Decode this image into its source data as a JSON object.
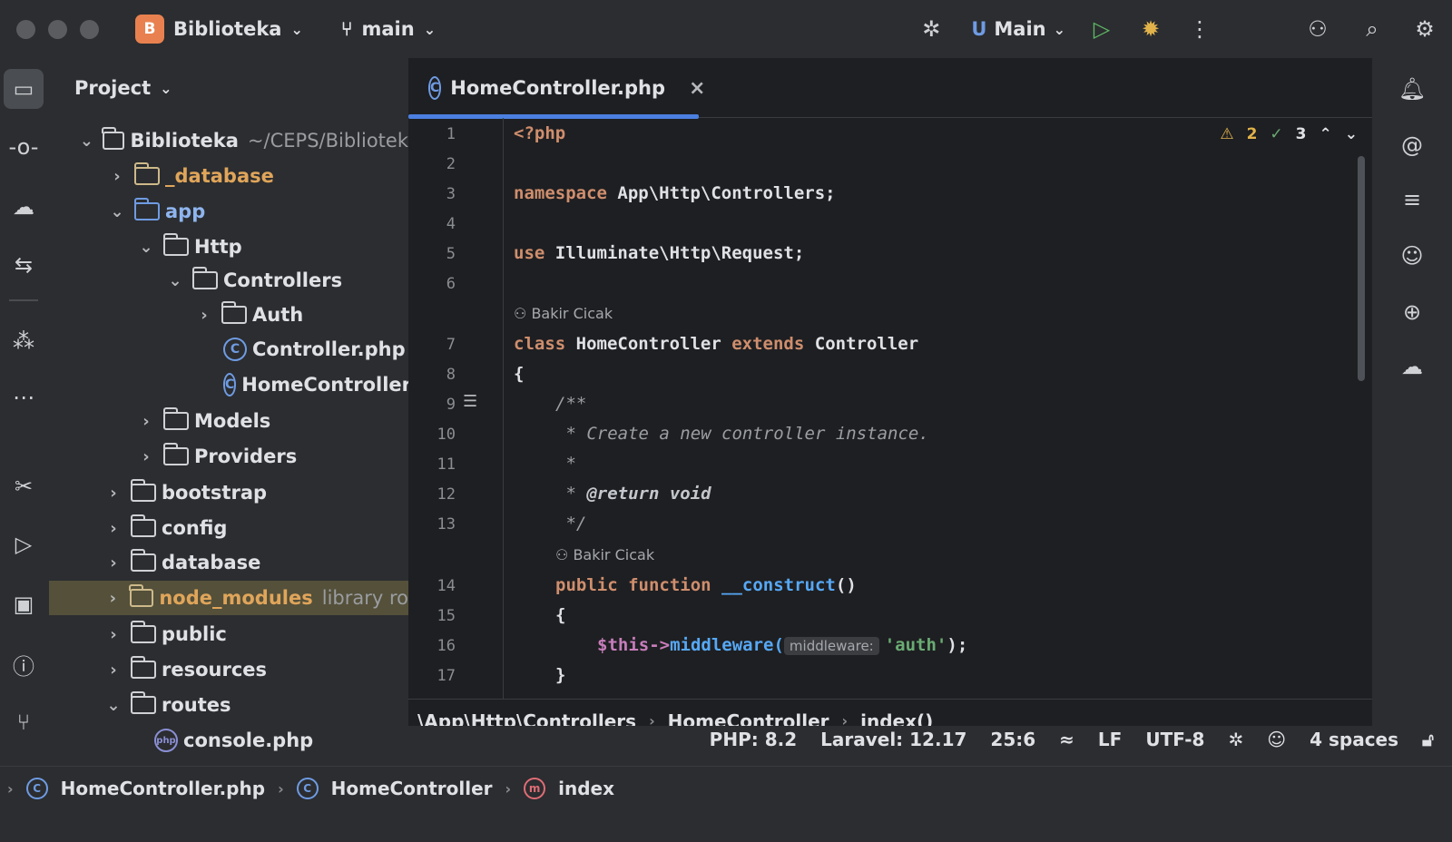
{
  "titlebar": {
    "project_badge": "B",
    "project_name": "Biblioteka",
    "branch": "main",
    "run_config": "Main"
  },
  "project_panel": {
    "title": "Project",
    "tree": [
      {
        "label": "Biblioteka",
        "suffix": "~/CEPS/Bibliotek",
        "kind": "folder",
        "expanded": true
      },
      {
        "label": "_database",
        "kind": "folder",
        "expanded": false
      },
      {
        "label": "app",
        "kind": "folder",
        "expanded": true
      },
      {
        "label": "Http",
        "kind": "folder",
        "expanded": true
      },
      {
        "label": "Controllers",
        "kind": "folder",
        "expanded": true
      },
      {
        "label": "Auth",
        "kind": "folder",
        "expanded": false
      },
      {
        "label": "Controller.php",
        "kind": "php"
      },
      {
        "label": "HomeController",
        "kind": "php"
      },
      {
        "label": "Models",
        "kind": "folder",
        "expanded": false
      },
      {
        "label": "Providers",
        "kind": "folder",
        "expanded": false
      },
      {
        "label": "bootstrap",
        "kind": "folder",
        "expanded": false
      },
      {
        "label": "config",
        "kind": "folder",
        "expanded": false
      },
      {
        "label": "database",
        "kind": "folder",
        "expanded": false
      },
      {
        "label": "node_modules",
        "suffix": "library ro",
        "kind": "folder",
        "expanded": false
      },
      {
        "label": "public",
        "kind": "folder",
        "expanded": false
      },
      {
        "label": "resources",
        "kind": "folder",
        "expanded": false
      },
      {
        "label": "routes",
        "kind": "folder",
        "expanded": true
      },
      {
        "label": "console.php",
        "kind": "php"
      }
    ]
  },
  "editor": {
    "tab_label": "HomeController.php",
    "tab_close": "×",
    "inspections": {
      "warnings": "2",
      "ok": "3"
    },
    "line_numbers": [
      "1",
      "2",
      "3",
      "4",
      "5",
      "6",
      "7",
      "8",
      "9",
      "10",
      "11",
      "12",
      "13",
      "14",
      "15",
      "16",
      "17"
    ],
    "code": {
      "l1": "<?php",
      "l3_kw": "namespace",
      "l3_rest": " App\\Http\\Controllers;",
      "l5_kw": "use",
      "l5_rest": " Illuminate\\Http\\Request;",
      "author1": "Bakir Cicak",
      "l7_kw1": "class",
      "l7_name": " HomeController ",
      "l7_kw2": "extends",
      "l7_parent": " Controller",
      "l8": "{",
      "l9": "/**",
      "l10": " * Create a new controller instance.",
      "l11": " *",
      "l12_a": " * ",
      "l12_tag": "@return",
      "l12_b": " void",
      "l13": " */",
      "author2": "Bakir Cicak",
      "l14_kw": "public function",
      "l14_fn": " __construct",
      "l14_rest": "()",
      "l15": "{",
      "l16_var": "$this->",
      "l16_fn": "middleware(",
      "l16_hint": "middleware:",
      "l16_str": "'auth'",
      "l16_end": ");",
      "l17": "}"
    },
    "breadcrumb": [
      "\\App\\Http\\Controllers",
      "HomeController",
      "index()"
    ]
  },
  "statusbar": {
    "path": [
      "HomeController.php",
      "HomeController",
      "index"
    ],
    "php": "PHP: 8.2",
    "laravel": "Laravel: 12.17",
    "position": "25:6",
    "line_sep": "LF",
    "encoding": "UTF-8",
    "indent": "4 spaces"
  }
}
